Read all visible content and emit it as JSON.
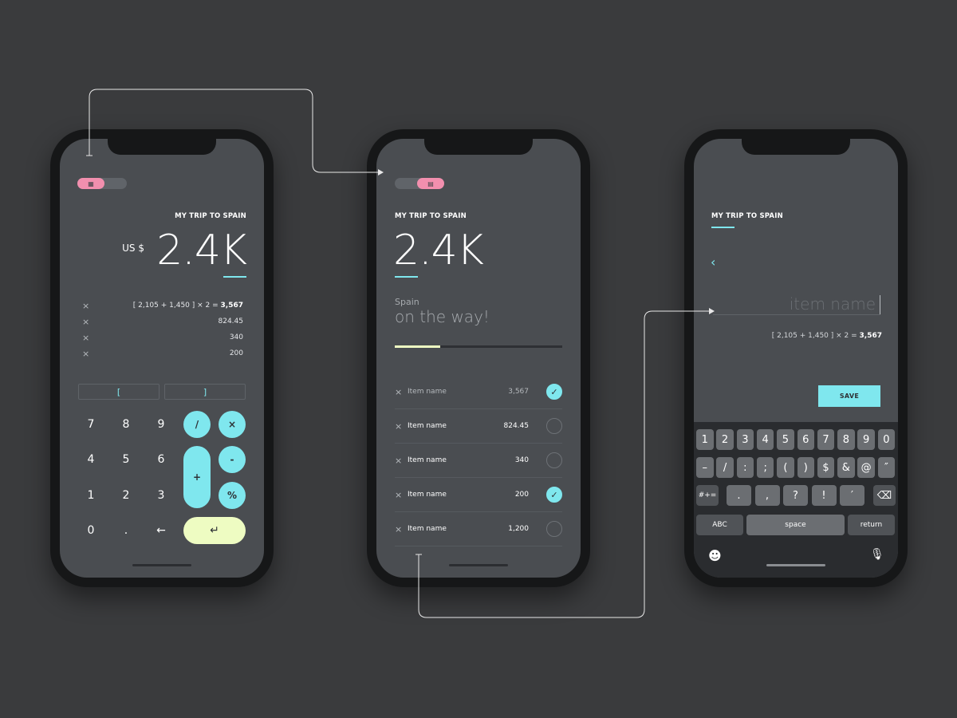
{
  "colors": {
    "background": "#3a3b3d",
    "screen": "#4a4d51",
    "accent": "#7fe7ee",
    "pink": "#f28fae",
    "enter": "#eefcc2"
  },
  "screen1": {
    "toggle_icon": "▦",
    "trip_title": "MY TRIP TO SPAIN",
    "currency": "US $",
    "amount": "2.4K",
    "rows": [
      {
        "remove": "×",
        "text": "[ 2,105 + 1,450 ] ×  2 = ",
        "bold": "3,567"
      },
      {
        "remove": "×",
        "text": "824.45",
        "bold": ""
      },
      {
        "remove": "×",
        "text": "340",
        "bold": ""
      },
      {
        "remove": "×",
        "text": "200",
        "bold": ""
      }
    ],
    "bracket_open": "[",
    "bracket_close": "]",
    "keys": {
      "k7": "7",
      "k8": "8",
      "k9": "9",
      "k4": "4",
      "k5": "5",
      "k6": "6",
      "k1": "1",
      "k2": "2",
      "k3": "3",
      "k0": "0",
      "dot": ".",
      "back": "←"
    },
    "ops": {
      "div": "/",
      "mul": "×",
      "minus": "-",
      "plus": "+",
      "pct": "%",
      "enter": "↵"
    }
  },
  "screen2": {
    "toggle_icon": "▤",
    "trip_title": "MY TRIP TO SPAIN",
    "amount": "2.4K",
    "place": "Spain",
    "status": "on the way!",
    "progress": 0.27,
    "items": [
      {
        "remove": "×",
        "name": "Item name",
        "value": "3,567",
        "checked": true,
        "dim": true
      },
      {
        "remove": "×",
        "name": "Item name",
        "value": "824.45",
        "checked": false,
        "dim": false
      },
      {
        "remove": "×",
        "name": "Item name",
        "value": "340",
        "checked": false,
        "dim": false
      },
      {
        "remove": "×",
        "name": "Item name",
        "value": "200",
        "checked": true,
        "dim": false
      },
      {
        "remove": "×",
        "name": "Item name",
        "value": "1,200",
        "checked": false,
        "dim": false
      }
    ],
    "check_mark": "✓"
  },
  "screen3": {
    "trip_title": "MY TRIP TO SPAIN",
    "back_icon": "‹",
    "input_placeholder": "item name",
    "formula": "[ 2,105 + 1,450 ] ×  2 = ",
    "formula_bold": "3,567",
    "save_label": "SAVE",
    "keyboard": {
      "row1": [
        "1",
        "2",
        "3",
        "4",
        "5",
        "6",
        "7",
        "8",
        "9",
        "0"
      ],
      "row2": [
        "–",
        "/",
        ":",
        ";",
        "(",
        ")",
        "$",
        "&",
        "@",
        "″"
      ],
      "row3_left": "#+=",
      "row3": [
        ".",
        ",",
        "?",
        "!",
        "′"
      ],
      "delete_icon": "⌫",
      "abc": "ABC",
      "space": "space",
      "return": "return",
      "emoji_icon": "☻",
      "mic_icon": "🎙"
    }
  }
}
